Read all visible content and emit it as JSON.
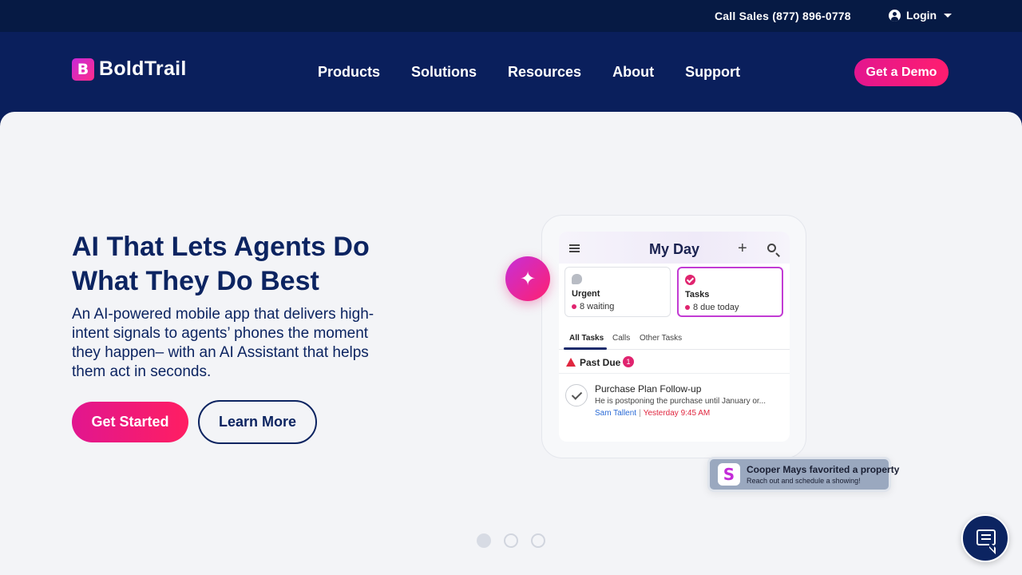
{
  "topbar": {
    "call_sales": "Call Sales (877) 896-0778",
    "login_label": "Login"
  },
  "header": {
    "logo_mark": "B",
    "logo_text": "BoldTrail",
    "nav": [
      {
        "label": "Products"
      },
      {
        "label": "Solutions"
      },
      {
        "label": "Resources"
      },
      {
        "label": "About"
      },
      {
        "label": "Support"
      }
    ],
    "demo_label": "Get a Demo"
  },
  "hero": {
    "title": "AI That Lets Agents Do What They Do Best",
    "subtitle": "An AI-powered mobile app that delivers high-intent signals to agents’ phones the moment they happen– with an AI Assistant that helps them act in seconds.",
    "get_started_label": "Get Started",
    "learn_more_label": "Learn More"
  },
  "phone": {
    "title": "My Day",
    "plus": "+",
    "cards": [
      {
        "title": "Urgent",
        "stat": "8 waiting"
      },
      {
        "title": "Tasks",
        "stat": "8 due today"
      }
    ],
    "tabs": [
      "All Tasks",
      "Calls",
      "Other Tasks"
    ],
    "past_due_label": "Past Due",
    "past_due_count": "1",
    "task": {
      "title": "Purchase Plan Follow-up",
      "desc": "He is postponing the purchase until January or...",
      "who": "Sam Tallent",
      "sep": "|",
      "when": "Yesterday 9:45 AM"
    }
  },
  "notification": {
    "logo": "S",
    "title": "Cooper Mays favorited a property",
    "subtitle": "Reach out and schedule a showing!"
  },
  "sparkle_glyph": "✦",
  "carousel": {
    "count": 3,
    "active": 0
  },
  "colors": {
    "navy": "#0a1f5c",
    "topbar": "#061a44",
    "accent_pink": "#e3168f",
    "hero_bg": "#f3f4f7"
  },
  "icons": {
    "user": "user-icon",
    "caret": "chevron-down-icon",
    "sparkle": "sparkle-icon",
    "chat": "chat-icon"
  }
}
